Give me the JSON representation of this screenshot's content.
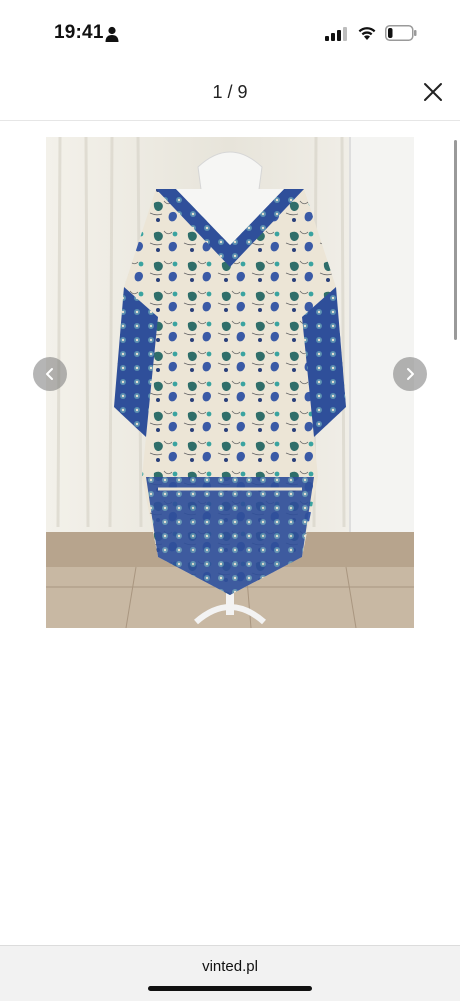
{
  "status_bar": {
    "time": "19:41",
    "icons": [
      "person-icon",
      "signal-icon",
      "wifi-icon",
      "battery-icon"
    ],
    "battery_level": 0.2
  },
  "header": {
    "counter": "1 / 9",
    "close_icon": "close-icon"
  },
  "viewer": {
    "photo_subject": "paisley-print-kaftan-on-mannequin",
    "prev_icon": "chevron-left-icon",
    "next_icon": "chevron-right-icon"
  },
  "browser": {
    "url": "vinted.pl"
  },
  "colors": {
    "accent_blue": "#2f4f9a",
    "nav_button_bg": "#8a8a8a",
    "bottom_bar_bg": "#f2f2f2"
  }
}
